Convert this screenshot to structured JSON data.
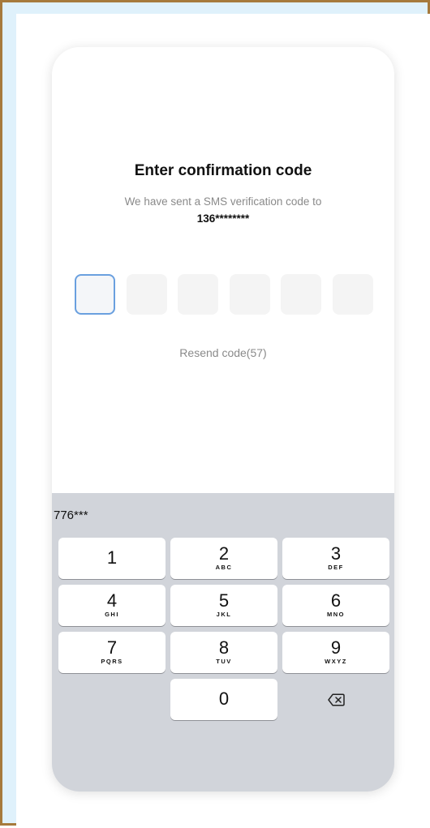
{
  "screen": {
    "title": "Enter confirmation code",
    "subtitle": "We have sent a SMS verification code to",
    "phone_number": "136********",
    "resend_label": "Resend code(57)"
  },
  "code_input": {
    "length": 6,
    "active_index": 0,
    "values": [
      "",
      "",
      "",
      "",
      "",
      ""
    ]
  },
  "keyboard": {
    "suggestion": "776***",
    "keys": [
      {
        "digit": "1",
        "letters": ""
      },
      {
        "digit": "2",
        "letters": "ABC"
      },
      {
        "digit": "3",
        "letters": "DEF"
      },
      {
        "digit": "4",
        "letters": "GHI"
      },
      {
        "digit": "5",
        "letters": "JKL"
      },
      {
        "digit": "6",
        "letters": "MNO"
      },
      {
        "digit": "7",
        "letters": "PQRS"
      },
      {
        "digit": "8",
        "letters": "TUV"
      },
      {
        "digit": "9",
        "letters": "WXYZ"
      },
      {
        "digit": "0",
        "letters": ""
      }
    ],
    "delete_icon": "backspace-icon"
  },
  "colors": {
    "frame_border": "#a67a3c",
    "frame_background": "#dff1fb",
    "active_box_border": "#6aa0df",
    "keyboard_background": "#d1d4da"
  }
}
